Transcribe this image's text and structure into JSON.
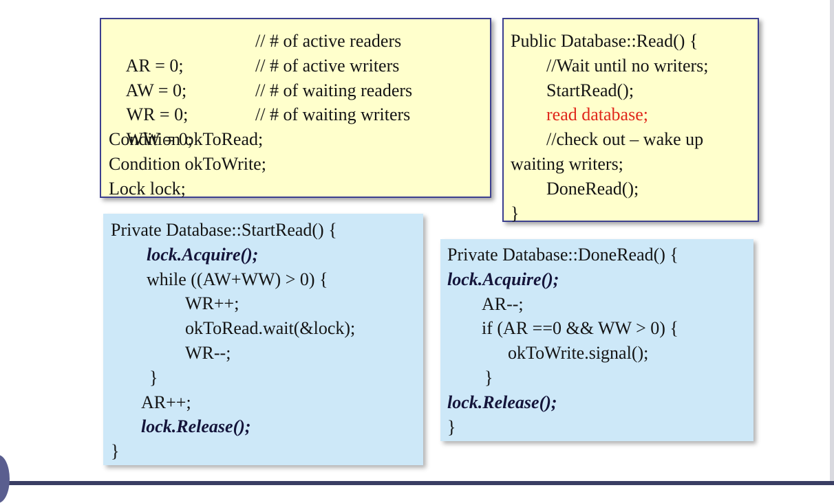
{
  "vars_box": {
    "lines": [
      {
        "code": "AR = 0;",
        "comment": "// # of active readers"
      },
      {
        "code": "AW = 0;",
        "comment": "// # of active writers"
      },
      {
        "code": "WR = 0;",
        "comment": "// # of waiting readers"
      },
      {
        "code": "WW = 0;",
        "comment": "// # of waiting writers"
      },
      {
        "code": "Condition okToRead;"
      },
      {
        "code": "Condition okToWrite;"
      },
      {
        "code": "Lock lock;"
      }
    ]
  },
  "read_box": {
    "lines": [
      "Public Database::Read() {",
      "//Wait until no writers;",
      "StartRead();",
      "read database;",
      "//check out – wake up",
      "waiting writers;",
      "DoneRead();",
      "}"
    ]
  },
  "startread_box": {
    "lines": [
      "Private Database::StartRead() {",
      "lock.Acquire();",
      "while ((AW+WW) > 0) {",
      "WR++;",
      "okToRead.wait(&lock);",
      "WR--;",
      "}",
      "AR++;",
      "lock.Release();",
      "}"
    ]
  },
  "doneread_box": {
    "lines": [
      "Private Database::DoneRead() {",
      "lock.Acquire();",
      "AR--;",
      "if (AR ==0 && WW > 0) {",
      "okToWrite.signal();",
      "}",
      "lock.Release();",
      "}"
    ]
  }
}
